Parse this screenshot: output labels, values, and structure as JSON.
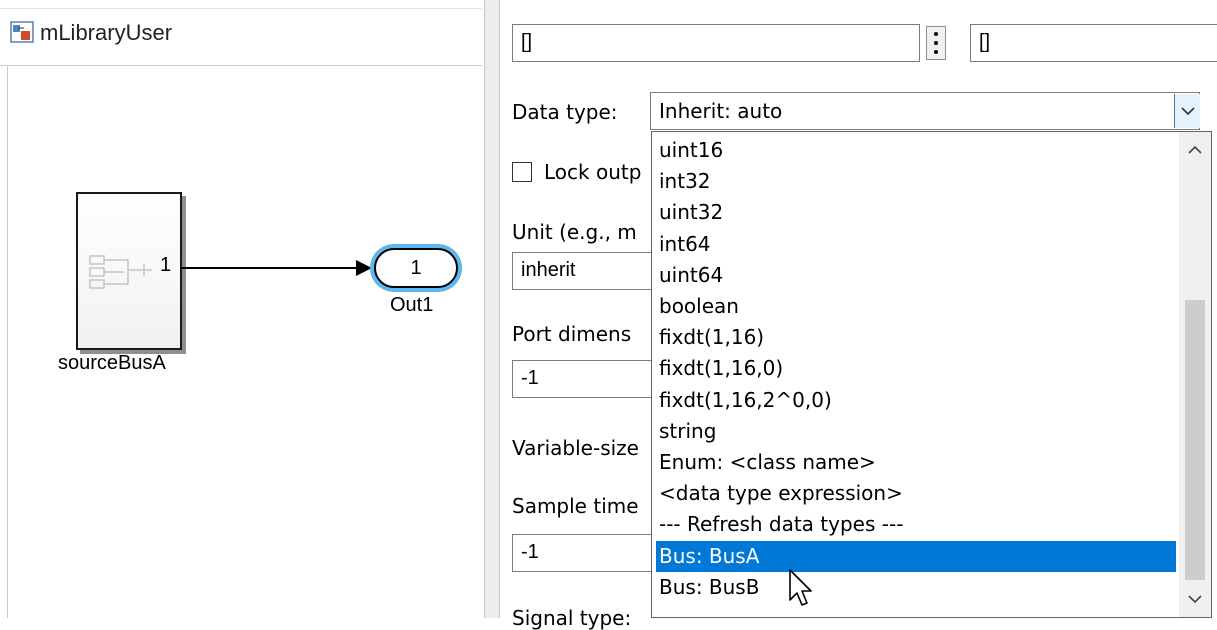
{
  "model": {
    "name": "mLibraryUser",
    "source_block": {
      "name": "sourceBusA",
      "port_label": "1"
    },
    "outport": {
      "name": "Out1",
      "number": "1"
    }
  },
  "panel": {
    "initial_value": "[]",
    "maximum_value": "[]",
    "data_type_label": "Data type:",
    "data_type_value": "Inherit: auto",
    "lock_label": "Lock outp",
    "unit_label": "Unit (e.g., m",
    "unit_value": "inherit",
    "port_dimensions_label": "Port dimens",
    "port_dimensions_value": "-1",
    "variable_size_label": "Variable-size",
    "sample_time_label": "Sample time",
    "sample_time_value": "-1",
    "signal_type_label": "Signal type:"
  },
  "dropdown": {
    "items": [
      "uint16",
      "int32",
      "uint32",
      "int64",
      "uint64",
      "boolean",
      "fixdt(1,16)",
      "fixdt(1,16,0)",
      "fixdt(1,16,2^0,0)",
      "string",
      "Enum: <class name>",
      "<data type expression>",
      "--- Refresh data types ---",
      "Bus: BusA",
      "Bus: BusB"
    ],
    "selected_index": 13
  },
  "colors": {
    "selection": "#0078d7",
    "outport_highlight": "#5db7ee"
  }
}
